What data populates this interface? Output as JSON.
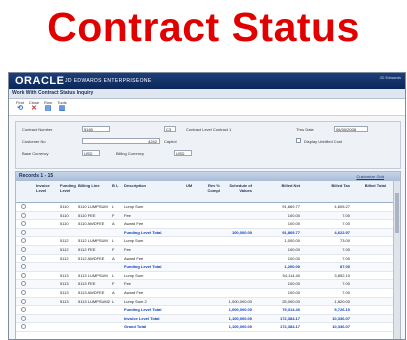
{
  "banner": {
    "title": "Contract Status"
  },
  "app": {
    "brand": "ORACLE",
    "suite": "JD EDWARDS ENTERPRISEONE",
    "header_right_top": "JD Edwards",
    "window_title": "Work With Contract Status Inquiry"
  },
  "toolbar": {
    "buttons": [
      {
        "label": "Find",
        "icon": "find-icon",
        "glyph": "⟲"
      },
      {
        "label": "Close",
        "icon": "close-icon",
        "glyph": "✕"
      },
      {
        "label": "Row",
        "icon": "row-icon",
        "glyph": "▤"
      },
      {
        "label": "Tools",
        "icon": "tools-icon",
        "glyph": "▥"
      }
    ]
  },
  "form": {
    "contract_number_label": "Contract Number",
    "contract_number_value": "5165",
    "contract_type_value": "C3",
    "contract_level_label": "Contract Level Contract 1",
    "customer_no_label": "Customer No",
    "customer_no_value": "4242",
    "customer_name": "Capitol",
    "base_currency_label": "Base Currency",
    "base_currency_value": "USD",
    "billing_currency_label": "Billing Currency",
    "billing_currency_value": "USD",
    "thru_date_label": "Thru Date",
    "thru_date_value": "06/30/2008",
    "display_unbilled_label": "Display Unbilled Cost"
  },
  "grid": {
    "title": "Records 1 - 15",
    "customize_link": "Customize Grid",
    "columns": [
      "Invoice Level",
      "Funding Level",
      "Billing Line",
      "B L",
      "Description",
      "UM",
      "Rev % Compl",
      "Schedule of Values",
      "Billed Net",
      "Billed Tax",
      "Billed Total"
    ],
    "rows": [
      {
        "inv": "",
        "fund": "5110",
        "line": "5110 LUMPSUM",
        "bl": "L",
        "desc": "Lump Sum",
        "um": "",
        "rev": "",
        "sov": "",
        "net": "91,669.77",
        "tax": "4,605.27",
        "total": "",
        "total_row": false
      },
      {
        "inv": "",
        "fund": "5110",
        "line": "5110 FEE",
        "bl": "F",
        "desc": "Fee",
        "um": "",
        "rev": "",
        "sov": "",
        "net": "100.00",
        "tax": "7.00",
        "total": "",
        "total_row": false
      },
      {
        "inv": "",
        "fund": "5110",
        "line": "5110 AWDFEE",
        "bl": "A",
        "desc": "Award Fee",
        "um": "",
        "rev": "",
        "sov": "",
        "net": "100.00",
        "tax": "7.00",
        "total": "",
        "total_row": false
      },
      {
        "inv": "",
        "fund": "",
        "line": "",
        "bl": "",
        "desc": "Funding Level Total",
        "um": "",
        "rev": "",
        "sov": "100,000.00",
        "net": "91,869.77",
        "tax": "4,622.97",
        "total": "",
        "total_row": true
      },
      {
        "inv": "",
        "fund": "5112",
        "line": "5112 LUMPSUM",
        "bl": "L",
        "desc": "Lump Sum",
        "um": "",
        "rev": "",
        "sov": "",
        "net": "1,000.00",
        "tax": "73.00",
        "total": "",
        "total_row": false
      },
      {
        "inv": "",
        "fund": "5112",
        "line": "5112 FEE",
        "bl": "F",
        "desc": "Fee",
        "um": "",
        "rev": "",
        "sov": "",
        "net": "100.00",
        "tax": "7.00",
        "total": "",
        "total_row": false
      },
      {
        "inv": "",
        "fund": "5112",
        "line": "5112 AWDFEE",
        "bl": "A",
        "desc": "Award Fee",
        "um": "",
        "rev": "",
        "sov": "",
        "net": "100.00",
        "tax": "7.00",
        "total": "",
        "total_row": false
      },
      {
        "inv": "",
        "fund": "",
        "line": "",
        "bl": "",
        "desc": "Funding Level Total",
        "um": "",
        "rev": "",
        "sov": "",
        "net": "1,200.00",
        "tax": "87.00",
        "total": "",
        "total_row": true
      },
      {
        "inv": "",
        "fund": "5113",
        "line": "5113 LUMPSUM",
        "bl": "L",
        "desc": "Lump Sum",
        "um": "",
        "rev": "",
        "sov": "",
        "net": "54,114.40",
        "tax": "3,892.10",
        "total": "",
        "total_row": false
      },
      {
        "inv": "",
        "fund": "5113",
        "line": "5113 FEE",
        "bl": "F",
        "desc": "Fee",
        "um": "",
        "rev": "",
        "sov": "",
        "net": "100.00",
        "tax": "7.00",
        "total": "",
        "total_row": false
      },
      {
        "inv": "",
        "fund": "5113",
        "line": "5113 AWDFEE",
        "bl": "A",
        "desc": "Award Fee",
        "um": "",
        "rev": "",
        "sov": "",
        "net": "100.00",
        "tax": "7.00",
        "total": "",
        "total_row": false
      },
      {
        "inv": "",
        "fund": "5113",
        "line": "5113 LUMPSUM2",
        "bl": "L",
        "desc": "Lump Sum 2",
        "um": "",
        "rev": "",
        "sov": "1,000,000.00",
        "net": "25,000.00",
        "tax": "1,820.00",
        "total": "",
        "total_row": false
      },
      {
        "inv": "",
        "fund": "",
        "line": "",
        "bl": "",
        "desc": "Funding Level Total",
        "um": "",
        "rev": "",
        "sov": "1,000,000.00",
        "net": "79,314.40",
        "tax": "5,726.10",
        "total": "",
        "total_row": true
      },
      {
        "inv": "",
        "fund": "",
        "line": "",
        "bl": "",
        "desc": "Invoice Level Total",
        "um": "",
        "rev": "",
        "sov": "1,100,000.00",
        "net": "172,384.17",
        "tax": "10,336.07",
        "total": "",
        "total_row": true
      },
      {
        "inv": "",
        "fund": "",
        "line": "",
        "bl": "",
        "desc": "Grand Total",
        "um": "",
        "rev": "",
        "sov": "1,100,000.00",
        "net": "172,384.17",
        "tax": "10,336.07",
        "total": "",
        "total_row": true
      }
    ]
  },
  "colors": {
    "banner_red": "#e00000",
    "header_navy": "#0b2657",
    "total_blue": "#0a3ec2"
  }
}
